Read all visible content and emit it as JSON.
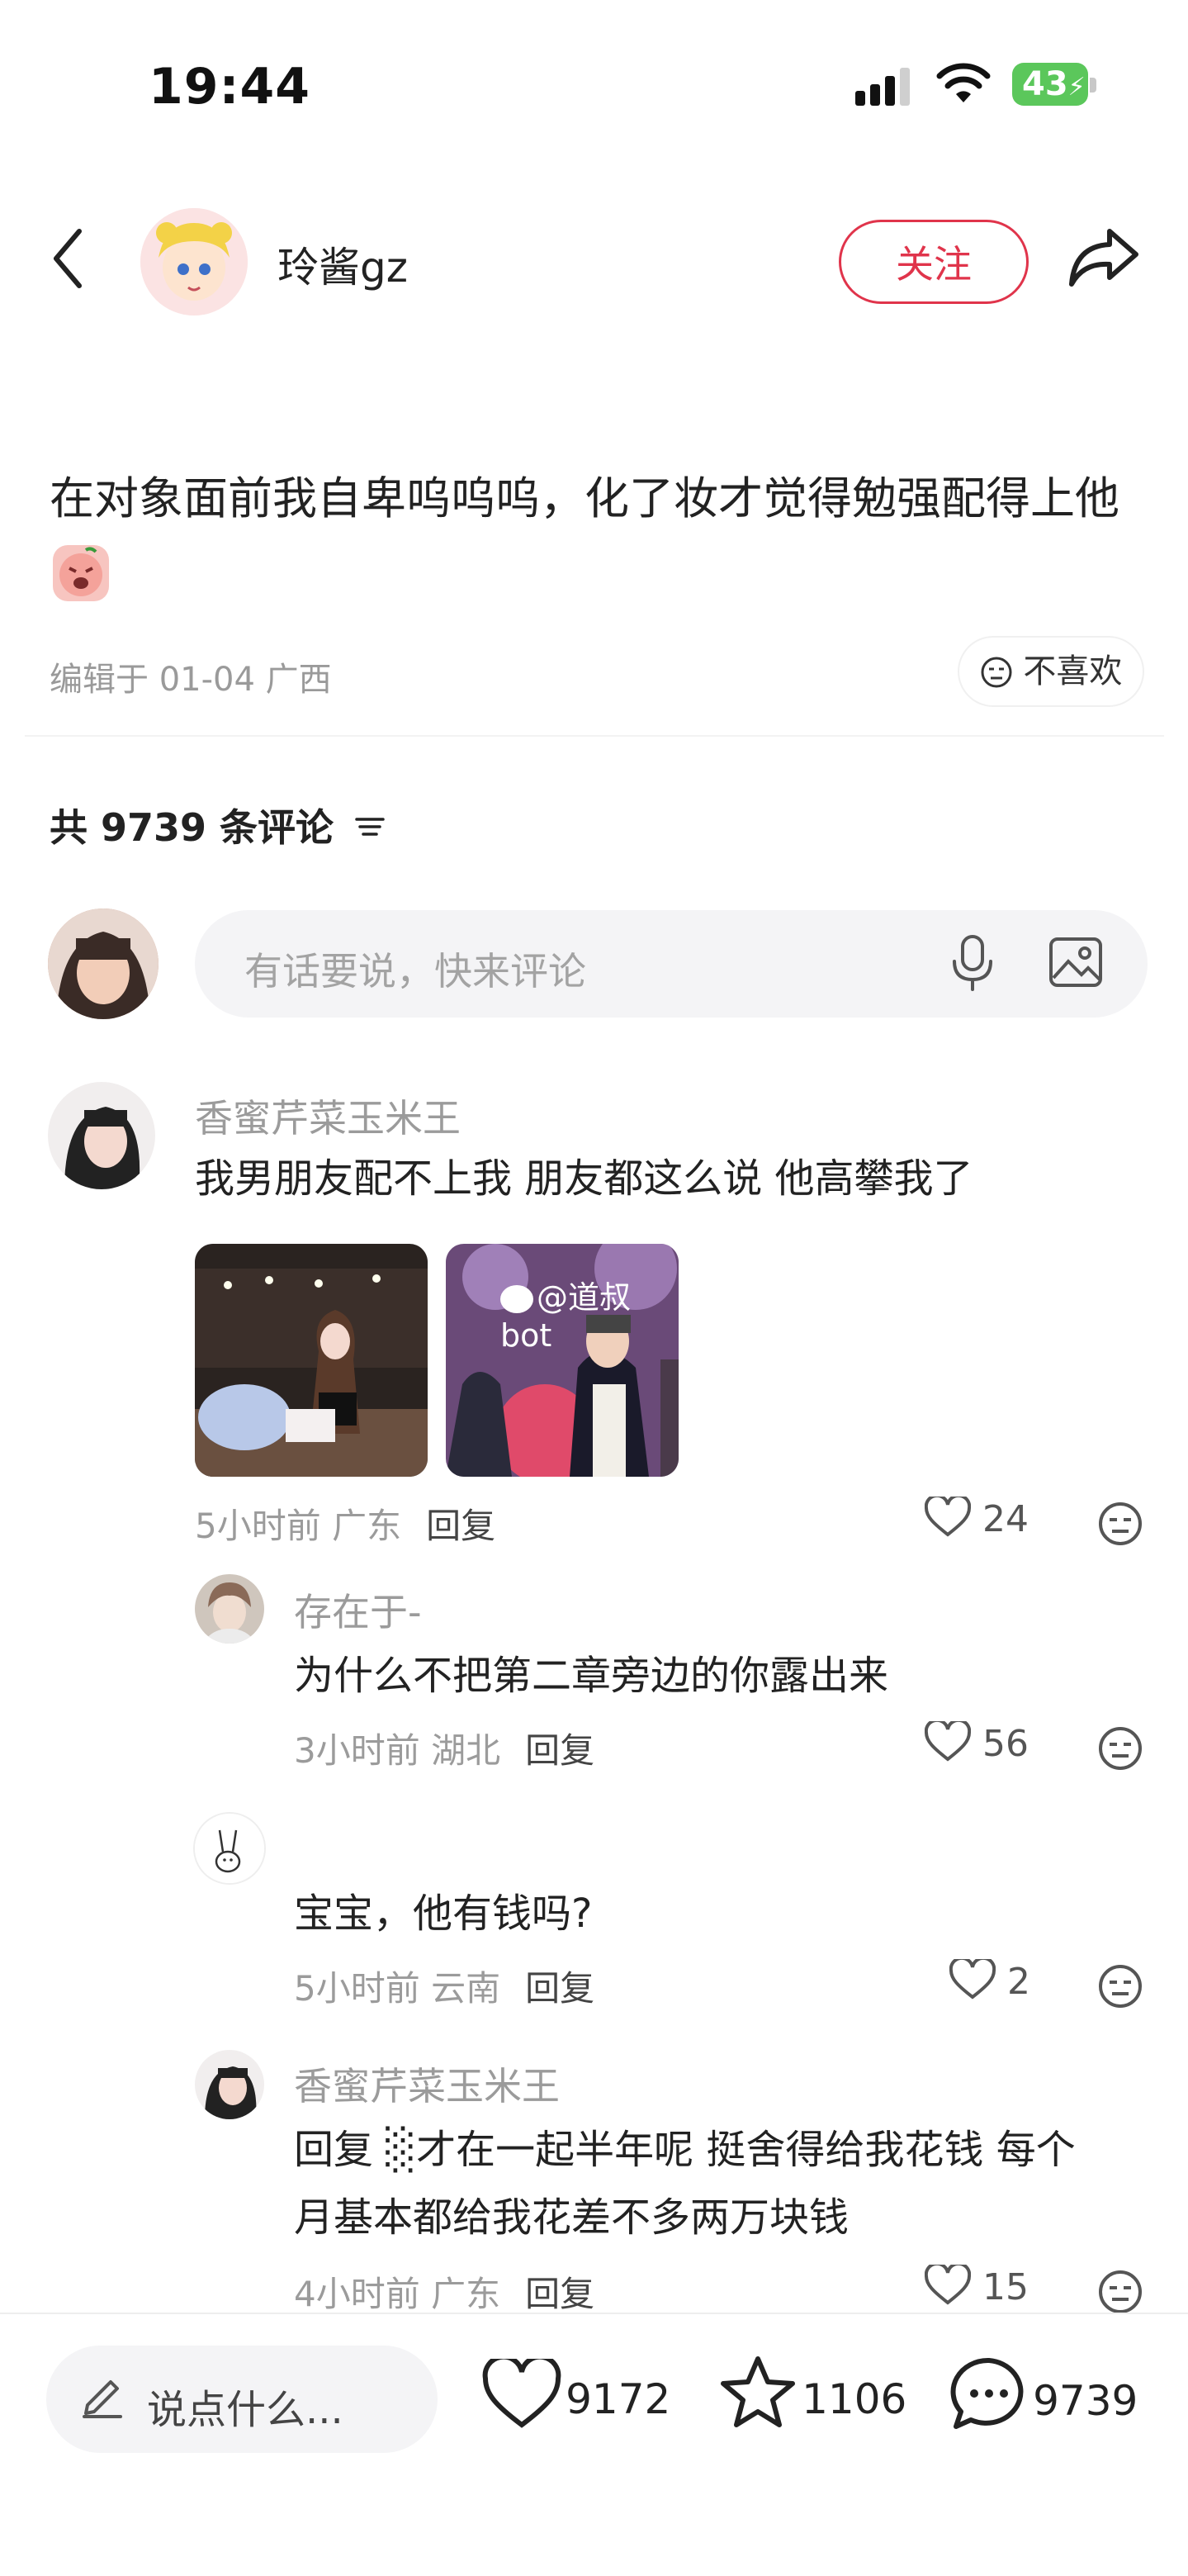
{
  "status_bar": {
    "time": "19:44",
    "battery": "43"
  },
  "header": {
    "author": "玲酱gz",
    "follow_label": "关注"
  },
  "post": {
    "text": "在对象面前我自卑呜呜呜，化了妆才觉得勉强配得上他",
    "edited": "编辑于 01-04 广西",
    "dislike_label": "不喜欢"
  },
  "comments_section": {
    "count_label": "共 9739 条评论",
    "input_placeholder": "有话要说，快来评论"
  },
  "comments": [
    {
      "user": "香蜜芹菜玉米王",
      "text": "我男朋友配不上我 朋友都这么说 他高攀我了",
      "time": "5小时前 广东",
      "reply": "回复",
      "likes": "24",
      "image_watermark": "@道叔bot"
    },
    {
      "user": "存在于-",
      "text": "为什么不把第二章旁边的你露出来",
      "time": "3小时前 湖北",
      "reply": "回复",
      "likes": "56"
    },
    {
      "user": "",
      "text": "宝宝，他有钱吗?",
      "time": "5小时前 云南",
      "reply": "回复",
      "likes": "2"
    },
    {
      "user": "香蜜芹菜玉米王",
      "text_line1": "回复 ░才在一起半年呢 挺舍得给我花钱 每个",
      "text_line2": "月基本都给我花差不多两万块钱",
      "time": "4小时前 广东",
      "reply": "回复",
      "likes": "15"
    }
  ],
  "bottom_bar": {
    "say_label": "说点什么...",
    "likes": "9172",
    "favorites": "1106",
    "comments": "9739"
  }
}
